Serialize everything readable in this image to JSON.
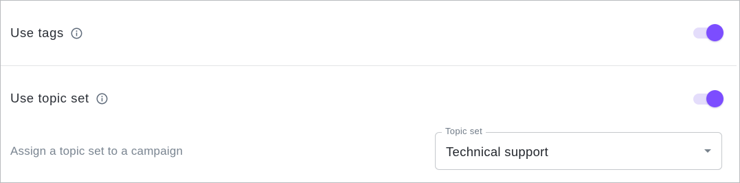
{
  "settings": {
    "tags": {
      "label": "Use tags",
      "info_icon": "info-circle-icon",
      "enabled": true
    },
    "topic_set": {
      "label": "Use topic set",
      "info_icon": "info-circle-icon",
      "enabled": true,
      "description": "Assign a topic set to a campaign",
      "select": {
        "legend": "Topic set",
        "value": "Technical support",
        "arrow_icon": "dropdown-caret-icon"
      }
    }
  },
  "colors": {
    "accent": "#7c4dff",
    "toggle_track": "#e4ddfb",
    "label_text": "#2a2e35",
    "muted_text": "#7a8591",
    "border": "#b9bbbe",
    "icon": "#5f6b7a"
  }
}
